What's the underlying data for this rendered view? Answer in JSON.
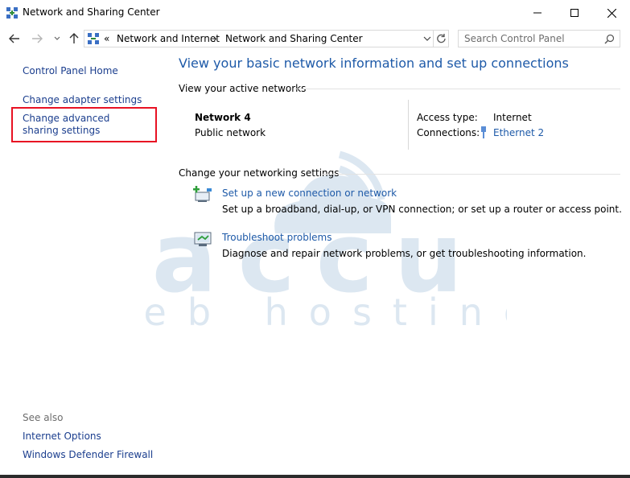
{
  "window": {
    "title": "Network and Sharing Center",
    "controls": {
      "minimize": "—",
      "maximize": "☐",
      "close": "✕"
    }
  },
  "address_bar": {
    "overflow": "«",
    "crumbs": [
      "Network and Internet",
      "Network and Sharing Center"
    ],
    "separator": "›"
  },
  "search": {
    "placeholder": "Search Control Panel"
  },
  "left_pane": {
    "home": "Control Panel Home",
    "items": [
      "Change adapter settings",
      "Change advanced sharing settings"
    ],
    "see_also_label": "See also",
    "see_also": [
      "Internet Options",
      "Windows Defender Firewall"
    ]
  },
  "main": {
    "title": "View your basic network information and set up connections",
    "active_networks_label": "View your active networks",
    "network": {
      "name": "Network 4",
      "type": "Public network",
      "access_type_label": "Access type:",
      "access_type_value": "Internet",
      "connections_label": "Connections:",
      "connections_value": "Ethernet 2"
    },
    "change_settings_label": "Change your networking settings",
    "tasks": [
      {
        "title": "Set up a new connection or network",
        "desc": "Set up a broadband, dial-up, or VPN connection; or set up a router or access point.",
        "icon": "new-connection-icon"
      },
      {
        "title": "Troubleshoot problems",
        "desc": "Diagnose and repair network problems, or get troubleshooting information.",
        "icon": "troubleshoot-icon"
      }
    ]
  },
  "watermark": {
    "line1": "accu",
    "line2": "web hosting"
  },
  "colors": {
    "link": "#1e5aa8",
    "left_link": "#1b3e8e",
    "highlight": "#e81123",
    "watermark": "#dce7f1"
  }
}
